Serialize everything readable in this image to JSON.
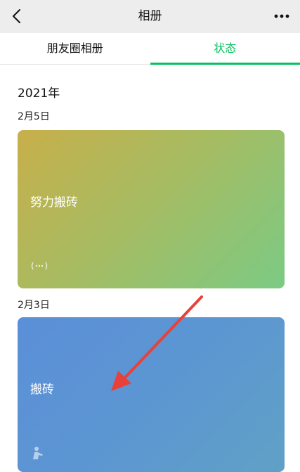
{
  "header": {
    "title": "相册",
    "back_icon": "chevron-left-icon",
    "more_icon": "more-dots-icon"
  },
  "tabs": [
    {
      "label": "朋友圈相册",
      "active": false
    },
    {
      "label": "状态",
      "active": true
    }
  ],
  "colors": {
    "accent": "#07c160",
    "header_bg": "#ededed"
  },
  "year": "2021年",
  "entries": [
    {
      "date": "2月5日",
      "status_text": "努力搬砖",
      "icon": "ellipsis-status-icon",
      "gradient": [
        "#c4b04a",
        "#7cca82"
      ]
    },
    {
      "date": "2月3日",
      "status_text": "搬砖",
      "icon": "person-working-icon",
      "gradient": [
        "#5b8fd6",
        "#5fa0c8"
      ]
    }
  ],
  "annotation": "red-arrow-pointer"
}
